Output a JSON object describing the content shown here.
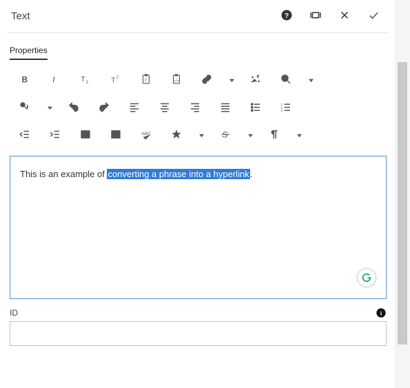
{
  "header": {
    "title": "Text"
  },
  "tabs": {
    "properties": "Properties"
  },
  "editor": {
    "plain_before": "This is an example of ",
    "selected_text": "converting a phrase into a hyperlink",
    "plain_after": "."
  },
  "fields": {
    "id": {
      "label": "ID",
      "value": ""
    }
  },
  "icons": {
    "help": "help-icon",
    "fullscreen": "fullscreen-icon",
    "close": "close-icon",
    "confirm": "check-icon",
    "bold": "bold-icon",
    "italic": "italic-icon",
    "subscript": "subscript-icon",
    "superscript": "superscript-icon",
    "paste_text": "paste-text-icon",
    "paste_code": "paste-code-icon",
    "link": "link-icon",
    "magic": "magic-clear-icon",
    "search": "search-icon",
    "replace": "replace-icon",
    "undo": "undo-icon",
    "redo": "redo-icon",
    "align_left": "align-left-icon",
    "align_center": "align-center-icon",
    "align_right": "align-right-icon",
    "align_justify": "align-justify-icon",
    "list_bullet": "list-bullet-icon",
    "list_number": "list-number-icon",
    "outdent": "outdent-icon",
    "indent": "indent-icon",
    "image": "image-icon",
    "table": "table-icon",
    "spellcheck": "spellcheck-icon",
    "star": "star-icon",
    "strike": "strike-icon",
    "pilcrow": "pilcrow-icon",
    "info": "info-icon",
    "grammarly": "grammarly-icon"
  }
}
